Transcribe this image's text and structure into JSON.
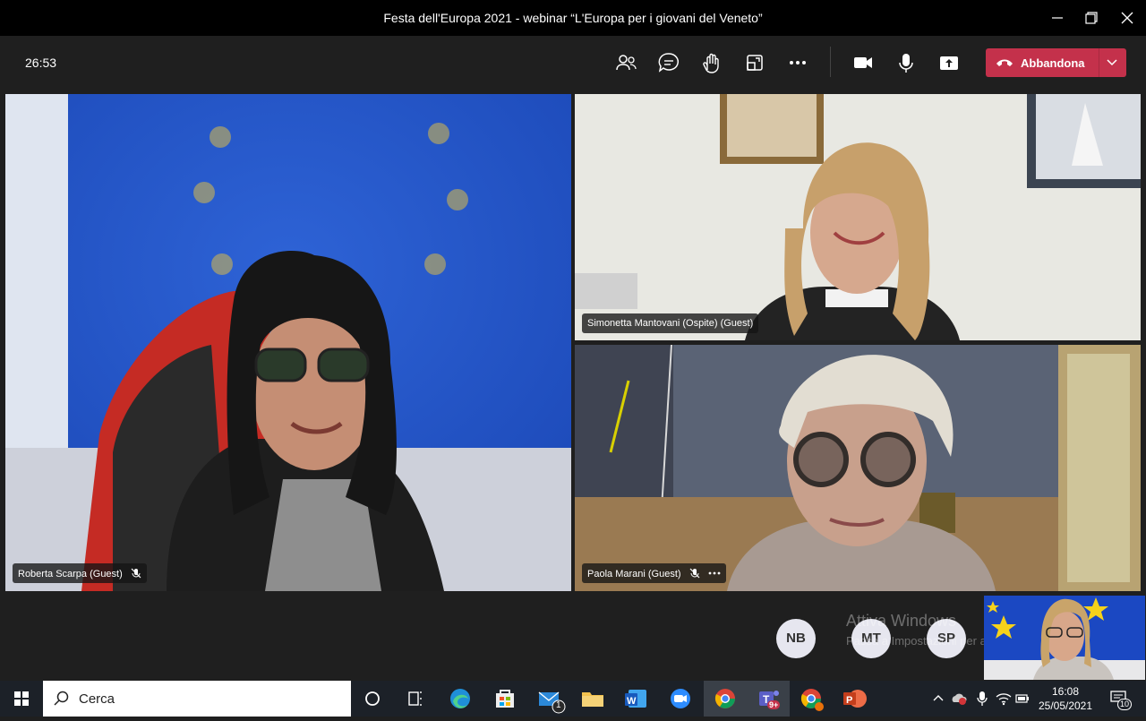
{
  "window": {
    "title": "Festa dell'Europa 2021 - webinar “L'Europa per i giovani del Veneto”"
  },
  "toolbar": {
    "timer": "26:53",
    "leave_label": "Abbandona"
  },
  "participants": [
    {
      "name": "Roberta Scarpa (Guest)",
      "muted": true
    },
    {
      "name": "Simonetta Mantovani (Ospite) (Guest)",
      "muted": false
    },
    {
      "name": "Paola Marani (Guest)",
      "muted": true
    }
  ],
  "avatars": [
    "NB",
    "MT",
    "SP"
  ],
  "watermark": {
    "line1": "Attiva Windows",
    "line2": "Passa a Impostazioni per attivare Windows."
  },
  "taskbar": {
    "search_placeholder": "Cerca",
    "mail_badge": "1",
    "teams_badge": "9+",
    "notification_count": "10",
    "time": "16:08",
    "date": "25/05/2021"
  },
  "colors": {
    "leave_button": "#c4314b",
    "toolbar_bg": "#1f1f1f",
    "title_bg": "#000000"
  }
}
